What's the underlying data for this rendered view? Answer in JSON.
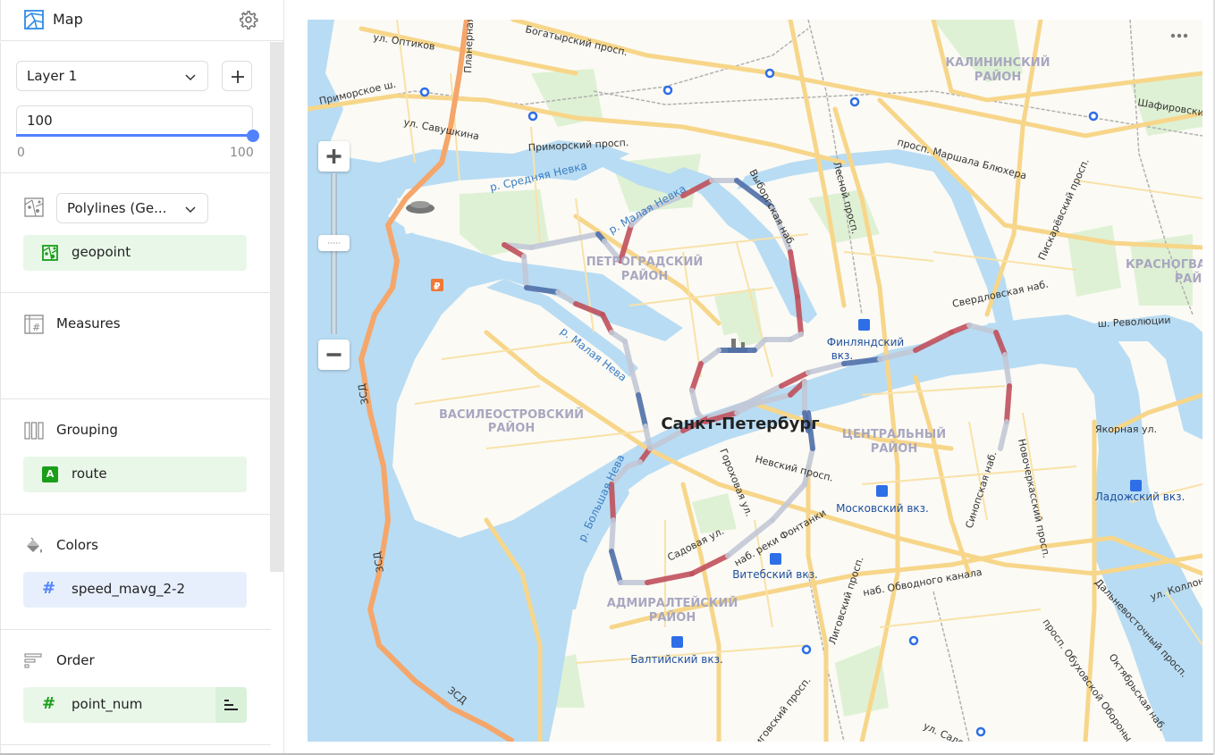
{
  "panel": {
    "title": "Map",
    "title_icon": "map-visualization-icon",
    "settings_icon": "gear-icon",
    "layer_select": {
      "value": "Layer 1"
    },
    "add_layer_icon": "plus-icon",
    "opacity": {
      "value": "100",
      "min_label": "0",
      "max_label": "100",
      "percent": 100
    },
    "geotype_select": {
      "value": "Polylines (Ge..."
    },
    "sections": {
      "geo": {
        "chip": {
          "label": "geopoint",
          "icon": "geopoint-icon",
          "color": "#1a9e1a"
        }
      },
      "measures": {
        "label": "Measures",
        "icon": "measures-icon"
      },
      "grouping": {
        "label": "Grouping",
        "icon": "grouping-icon",
        "chip": {
          "label": "route",
          "icon": "string-type-icon",
          "icon_text": "A",
          "color": "#1a9e1a"
        }
      },
      "colors": {
        "label": "Colors",
        "icon": "paint-bucket-icon",
        "chip": {
          "label": "speed_mavg_2-2",
          "icon": "number-type-icon",
          "icon_text": "#",
          "color": "#5282ff"
        }
      },
      "order": {
        "label": "Order",
        "icon": "sort-icon",
        "chip": {
          "label": "point_num",
          "icon": "number-type-icon",
          "icon_text": "#",
          "color": "#1a9e1a",
          "sort_icon": "sort-direction-icon"
        }
      }
    }
  },
  "map": {
    "more_icon": "more-horizontal-icon",
    "zoom_in_icon": "plus-icon",
    "zoom_out_icon": "minus-icon",
    "city_label": "Санкт-Петербург",
    "districts": [
      {
        "name": "КАЛИНИНСКИЙ",
        "line2": "РАЙОН"
      },
      {
        "name": "ПЕТРОГРАДСКИЙ",
        "line2": "РАЙОН"
      },
      {
        "name": "ВАСИЛЕОСТРОВСКИЙ",
        "line2": "РАЙОН"
      },
      {
        "name": "ЦЕНТРАЛЬНЫЙ",
        "line2": "РАЙОН"
      },
      {
        "name": "АДМИРАЛТЕЙСКИЙ",
        "line2": "РАЙОН"
      },
      {
        "name": "КРАСНОГВА",
        "line2": "РАЙ"
      }
    ],
    "streets": {
      "optikov": "ул. Оптиков",
      "planernaya": "Планерная ул.",
      "bogatyrsky": "Богатырский просп.",
      "primorskoe": "Приморское ш.",
      "savushkina": "ул. Савушкина",
      "primorsky": "Приморский просп.",
      "shafirovsky": "Шафировский",
      "blyukhera": "просп. Маршала Блюхера",
      "piskarevsky": "Пискарёвский просп.",
      "lesnoy": "Лесной просп.",
      "vyborgskaya": "Выборгская наб.",
      "sverdlovskaya": "Свердловская наб.",
      "revolyutsii": "ш. Революции",
      "yakornaya": "Якорная ул.",
      "sinopskaya": "Синопская наб.",
      "novocherkassky": "Новочеркасский просп.",
      "nevsky": "Невский просп.",
      "gorokhovaya": "Гороховая ул.",
      "sadovaya": "Садовая ул.",
      "fontanki": "наб. реки Фонтанки",
      "ligovsky": "Лиговский просп.",
      "ligovsky2": "Лиговский просп.",
      "obvodnogo": "наб. Обводного канала",
      "dalnevostochny": "Дальневосточный просп.",
      "kollontai": "ул. Коллонт",
      "obukhovskoy": "просп. Обуховской Обороны",
      "oktyabrskaya": "Октябрьская наб.",
      "salova": "ул. Салова",
      "zsd1": "ЗСД",
      "zsd2": "ЗСД",
      "zsd3": "ЗСД"
    },
    "rivers": {
      "srednyaya_nevka": "р. Средняя Невка",
      "malaya_nevka": "р. Малая Невка",
      "malaya_neva": "р. Малая Нева",
      "bolshaya_neva": "р. Большая Нева"
    },
    "stations": {
      "finlyandsky": "Финляндский",
      "finlyandsky2": "вкз.",
      "moskovsky": "Московский вкз.",
      "vitebsky": "Витебский вкз.",
      "baltiysky": "Балтийский вкз.",
      "ladozhsky": "Ладожский вкз."
    },
    "polyline_colors": {
      "slow": "#c0505c",
      "mid": "#c2c8d6",
      "fast": "#4f6fa8"
    }
  }
}
